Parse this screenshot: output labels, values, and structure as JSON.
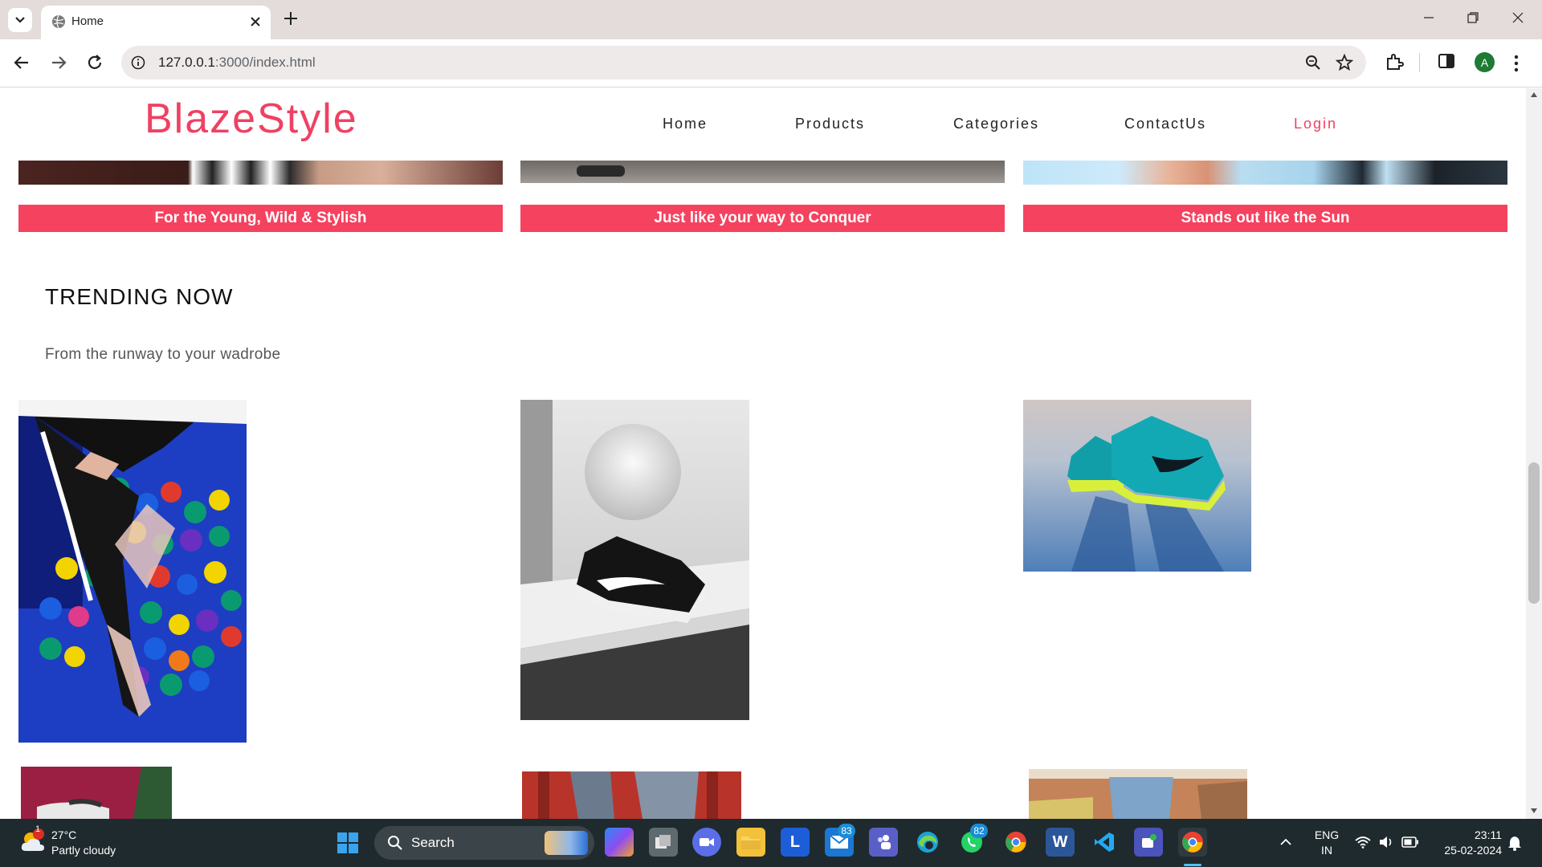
{
  "browser": {
    "tab_title": "Home",
    "url_host": "127.0.0.1",
    "url_path": ":3000/index.html",
    "profile_initial": "A"
  },
  "site": {
    "logo": "BlazeStyle",
    "nav": [
      {
        "label": "Home"
      },
      {
        "label": "Products"
      },
      {
        "label": "Categories"
      },
      {
        "label": "ContactUs"
      },
      {
        "label": "Login"
      }
    ],
    "banners": [
      {
        "label": "For the Young, Wild & Stylish"
      },
      {
        "label": "Just like your way to Conquer"
      },
      {
        "label": "Stands out like the Sun"
      }
    ],
    "trending_title": "TRENDING NOW",
    "trending_subtitle": "From the runway to your wadrobe"
  },
  "taskbar": {
    "weather_temp": "27°C",
    "weather_desc": "Partly cloudy",
    "weather_badge": "1",
    "search_label": "Search",
    "mail_badge": "83",
    "whatsapp_badge": "82",
    "lang_line1": "ENG",
    "lang_line2": "IN",
    "time": "23:11",
    "date": "25-02-2024"
  },
  "colors": {
    "brand": "#ef4163",
    "banner": "#f5425f"
  }
}
